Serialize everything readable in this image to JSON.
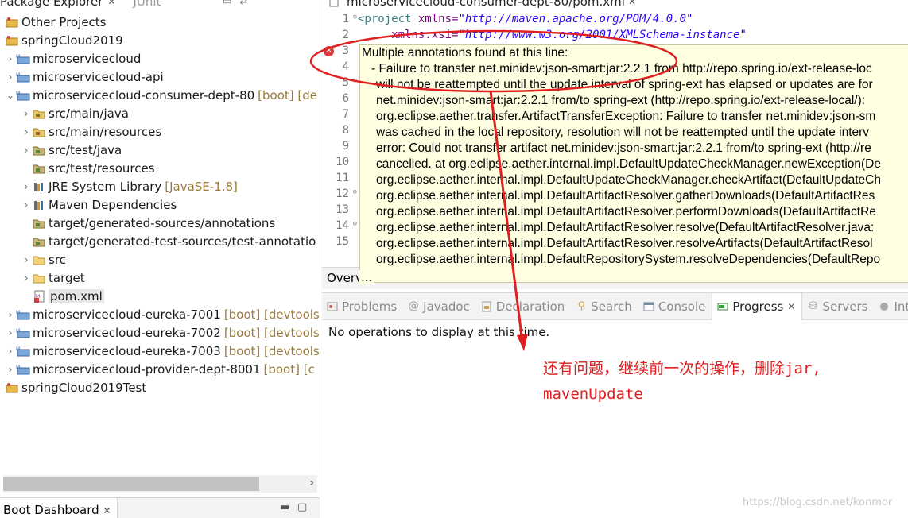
{
  "left_panel": {
    "tab_title": "Package Explorer",
    "junit_tab": "JUnit",
    "tree": [
      {
        "label": "Other Projects",
        "deco": ""
      },
      {
        "label": "springCloud2019",
        "deco": ""
      },
      {
        "label": "microservicecloud",
        "deco": ""
      },
      {
        "label": "microservicecloud-api",
        "deco": ""
      },
      {
        "label": "microservicecloud-consumer-dept-80",
        "deco": "[boot] [de"
      },
      {
        "label": "src/main/java",
        "deco": ""
      },
      {
        "label": "src/main/resources",
        "deco": ""
      },
      {
        "label": "src/test/java",
        "deco": ""
      },
      {
        "label": "src/test/resources",
        "deco": ""
      },
      {
        "label": "JRE System Library",
        "deco": "[JavaSE-1.8]"
      },
      {
        "label": "Maven Dependencies",
        "deco": ""
      },
      {
        "label": "target/generated-sources/annotations",
        "deco": ""
      },
      {
        "label": "target/generated-test-sources/test-annotatio",
        "deco": ""
      },
      {
        "label": "src",
        "deco": ""
      },
      {
        "label": "target",
        "deco": ""
      },
      {
        "label": "pom.xml",
        "deco": ""
      },
      {
        "label": "microservicecloud-eureka-7001",
        "deco": "[boot] [devtools"
      },
      {
        "label": "microservicecloud-eureka-7002",
        "deco": "[boot] [devtools"
      },
      {
        "label": "microservicecloud-eureka-7003",
        "deco": "[boot] [devtools"
      },
      {
        "label": "microservicecloud-provider-dept-8001",
        "deco": "[boot] [c"
      },
      {
        "label": "springCloud2019Test",
        "deco": ""
      }
    ],
    "boot_dashboard_tab": "Boot Dashboard"
  },
  "editor": {
    "tab_title": "microservicecloud-consumer-dept-80/pom.xml",
    "line_numbers": [
      "1",
      "2",
      "3",
      "4",
      "5",
      "6",
      "7",
      "8",
      "9",
      "10",
      "11",
      "12",
      "13",
      "14",
      "15"
    ],
    "code": {
      "l1_tag": "<project ",
      "l1_attr": "xmlns=",
      "l1_val": "\"http://maven.apache.org/POM/4.0.0\"",
      "l2_attr": "xmlns:xsi=",
      "l2_val": "\"http://www.w3.org/2001/XMLSchema-instance\""
    },
    "hover": [
      "Multiple annotations found at this line:",
      "- Failure to transfer net.minidev:json-smart:jar:2.2.1 from http://repo.spring.io/ext-release-loc",
      "will not be reattempted until the update interval of spring-ext has elapsed or updates are for",
      "net.minidev:json-smart:jar:2.2.1 from/to spring-ext (http://repo.spring.io/ext-release-local/):",
      "org.eclipse.aether.transfer.ArtifactTransferException: Failure to transfer net.minidev:json-sm",
      "was cached in the local repository, resolution will not be reattempted until the update interv",
      "error: Could not transfer artifact net.minidev:json-smart:jar:2.2.1 from/to spring-ext (http://re",
      "cancelled. at org.eclipse.aether.internal.impl.DefaultUpdateCheckManager.newException(De",
      "org.eclipse.aether.internal.impl.DefaultUpdateCheckManager.checkArtifact(DefaultUpdateCh",
      "org.eclipse.aether.internal.impl.DefaultArtifactResolver.gatherDownloads(DefaultArtifactRes",
      "org.eclipse.aether.internal.impl.DefaultArtifactResolver.performDownloads(DefaultArtifactRe",
      "org.eclipse.aether.internal.impl.DefaultArtifactResolver.resolve(DefaultArtifactResolver.java:",
      "org.eclipse.aether.internal.impl.DefaultArtifactResolver.resolveArtifacts(DefaultArtifactResol",
      "org.eclipse.aether.internal.impl.DefaultRepositorySystem.resolveDependencies(DefaultRepo"
    ],
    "bottom_tab": "Overv...",
    "overview_partial": "Overv",
    "ellipsis": "..."
  },
  "bottom_panel": {
    "tabs": [
      "Problems",
      "Javadoc",
      "Declaration",
      "Search",
      "Console",
      "Progress",
      "Servers",
      "Interna"
    ],
    "active_tab": "Progress",
    "message": "No operations to display at this time."
  },
  "annotation": {
    "line1": "还有问题，继续前一次的操作，删除jar,",
    "line2": "mavenUpdate",
    "color": "#e02020"
  },
  "watermark": "https://blog.csdn.net/konmor"
}
